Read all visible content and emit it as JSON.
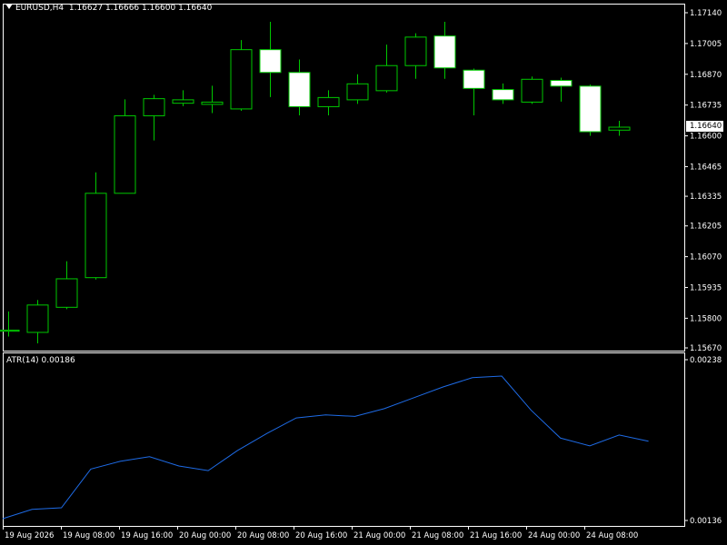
{
  "header": {
    "symbol": "EURUSD,H4",
    "ohlc": "1.16627 1.16666 1.16600 1.16640"
  },
  "indicator": {
    "label": "ATR(14) 0.00186"
  },
  "current_price": "1.16640",
  "colors": {
    "background": "#000000",
    "frame": "#FFFFFF",
    "bull": "#00C800",
    "bear_fill": "#FFFFFF",
    "atr_line": "#1E6BE6",
    "text": "#FFFFFF"
  },
  "chart_data": [
    {
      "type": "candlestick",
      "ylim": [
        1.1567,
        1.1714
      ],
      "ytick_labels": [
        "1.17140",
        "1.17005",
        "1.16870",
        "1.16735",
        "1.16600",
        "1.16465",
        "1.16335",
        "1.16205",
        "1.16070",
        "1.15935",
        "1.15800",
        "1.15670"
      ],
      "ytick_values": [
        1.1714,
        1.17005,
        1.1687,
        1.16735,
        1.166,
        1.16465,
        1.16335,
        1.16205,
        1.1607,
        1.15935,
        1.158,
        1.1567
      ],
      "candles": [
        {
          "o": 1.15745,
          "h": 1.1583,
          "l": 1.1572,
          "c": 1.1575
        },
        {
          "o": 1.1574,
          "h": 1.1588,
          "l": 1.1569,
          "c": 1.1586
        },
        {
          "o": 1.1585,
          "h": 1.1605,
          "l": 1.1584,
          "c": 1.15975
        },
        {
          "o": 1.1598,
          "h": 1.1644,
          "l": 1.1597,
          "c": 1.1635
        },
        {
          "o": 1.1635,
          "h": 1.1676,
          "l": 1.1635,
          "c": 1.1669
        },
        {
          "o": 1.1669,
          "h": 1.1678,
          "l": 1.1658,
          "c": 1.16765
        },
        {
          "o": 1.16745,
          "h": 1.168,
          "l": 1.1673,
          "c": 1.1676
        },
        {
          "o": 1.1674,
          "h": 1.1682,
          "l": 1.167,
          "c": 1.1675
        },
        {
          "o": 1.1672,
          "h": 1.1702,
          "l": 1.1671,
          "c": 1.1698
        },
        {
          "o": 1.1698,
          "h": 1.171,
          "l": 1.1677,
          "c": 1.1688
        },
        {
          "o": 1.1688,
          "h": 1.16935,
          "l": 1.1669,
          "c": 1.1673
        },
        {
          "o": 1.1673,
          "h": 1.168,
          "l": 1.1669,
          "c": 1.1677
        },
        {
          "o": 1.1676,
          "h": 1.1687,
          "l": 1.1674,
          "c": 1.1683
        },
        {
          "o": 1.168,
          "h": 1.17,
          "l": 1.1679,
          "c": 1.1691
        },
        {
          "o": 1.1691,
          "h": 1.1705,
          "l": 1.1685,
          "c": 1.17035
        },
        {
          "o": 1.1704,
          "h": 1.171,
          "l": 1.1685,
          "c": 1.169
        },
        {
          "o": 1.1689,
          "h": 1.16895,
          "l": 1.1669,
          "c": 1.1681
        },
        {
          "o": 1.16805,
          "h": 1.1683,
          "l": 1.1674,
          "c": 1.1676
        },
        {
          "o": 1.1675,
          "h": 1.1686,
          "l": 1.1674,
          "c": 1.1685
        },
        {
          "o": 1.16845,
          "h": 1.16855,
          "l": 1.1675,
          "c": 1.1682
        },
        {
          "o": 1.1682,
          "h": 1.16825,
          "l": 1.166,
          "c": 1.1662
        },
        {
          "o": 1.16627,
          "h": 1.16666,
          "l": 1.166,
          "c": 1.1664
        }
      ]
    },
    {
      "type": "line",
      "series": [
        {
          "name": "ATR(14)",
          "values": [
            0.00136,
            0.00142,
            0.00143,
            0.00168,
            0.00173,
            0.00176,
            0.0017,
            0.00167,
            0.0018,
            0.00191,
            0.00201,
            0.00203,
            0.00202,
            0.00207,
            0.00214,
            0.00221,
            0.00227,
            0.00228,
            0.00206,
            0.00188,
            0.00183,
            0.0019,
            0.00186
          ]
        }
      ],
      "ylim": [
        0.00136,
        0.00238
      ],
      "ytick_labels": [
        "0.00238",
        "0.00136"
      ],
      "ytick_values": [
        0.00238,
        0.00136
      ]
    }
  ],
  "time_labels": [
    "19 Aug 2026",
    "19 Aug 08:00",
    "19 Aug 16:00",
    "20 Aug 00:00",
    "20 Aug 08:00",
    "20 Aug 16:00",
    "21 Aug 00:00",
    "21 Aug 08:00",
    "21 Aug 16:00",
    "24 Aug 00:00",
    "24 Aug 08:00"
  ]
}
